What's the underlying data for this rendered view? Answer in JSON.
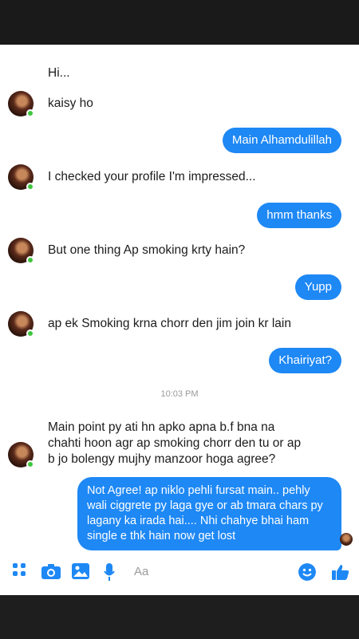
{
  "messages": {
    "m1": "Hi...",
    "m2": "kaisy ho",
    "m3": "Main Alhamdulillah",
    "m4": "I checked your profile I'm impressed...",
    "m5": "hmm thanks",
    "m6": "But one thing Ap smoking krty hain?",
    "m7": "Yupp",
    "m8": "ap ek Smoking krna chorr den jim join kr lain",
    "m9": "Khairiyat?",
    "m10": "Main point py ati hn apko apna b.f bna na chahti hoon agr ap smoking chorr den tu or ap b jo bolengy mujhy manzoor hoga agree?",
    "m11": "Not Agree! ap niklo pehli fursat main.. pehly wali ciggrete py laga gye or ab tmara chars py lagany ka irada hai.... Nhi chahye bhai ham single e thk hain now get lost"
  },
  "timestamp": "10:03 PM",
  "composer": {
    "placeholder": "Aa",
    "icons": [
      "grid-icon",
      "camera-icon",
      "photo-icon",
      "mic-icon",
      "emoji-icon",
      "like-icon"
    ]
  },
  "colors": {
    "outgoing_bubble": "#1e88f5",
    "online_dot": "#3ec63e",
    "accent": "#1e88f5"
  }
}
